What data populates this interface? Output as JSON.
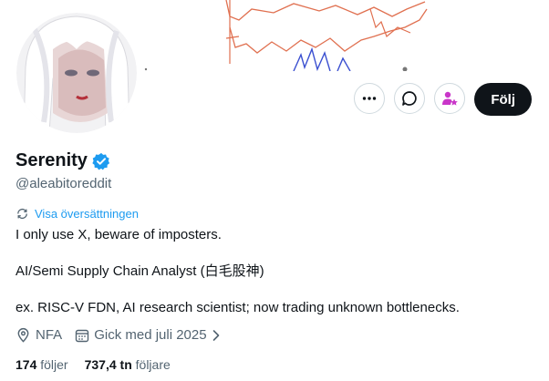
{
  "profile": {
    "display_name": "Serenity",
    "handle": "@aleabitoreddit",
    "verified": true,
    "accent": "#1d9bf0"
  },
  "actions": {
    "more_icon": "more-horizontal-icon",
    "message_icon": "message-bubble-icon",
    "subscribe_icon": "person-star-icon",
    "follow_label": "Följ"
  },
  "translate": {
    "label": "Visa översättningen"
  },
  "bio": {
    "line1": "I only use X, beware of imposters.",
    "line2": "AI/Semi Supply Chain Analyst (白毛股神)",
    "line3": "ex. RISC-V FDN, AI research scientist; now trading unknown bottlenecks."
  },
  "meta": {
    "location": "NFA",
    "joined": "Gick med juli 2025"
  },
  "stats": {
    "following_count": "174",
    "following_label": "följer",
    "followers_count": "737,4 tn",
    "followers_label": "följare"
  }
}
